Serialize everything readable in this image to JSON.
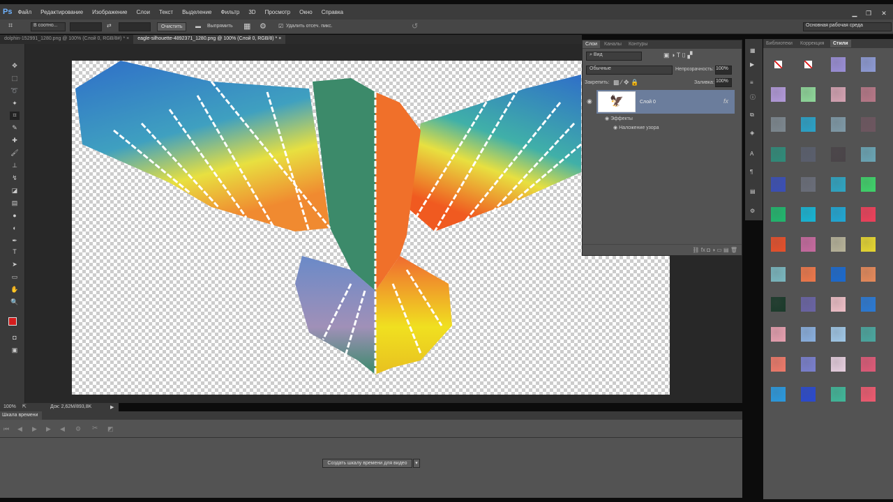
{
  "menu": {
    "logo": "Ps",
    "items": [
      "Файл",
      "Редактирование",
      "Изображение",
      "Слои",
      "Текст",
      "Выделение",
      "Фильтр",
      "3D",
      "Просмотр",
      "Окно",
      "Справка"
    ]
  },
  "window": {
    "minimize": "▁",
    "restore": "❐",
    "close": "✕"
  },
  "options": {
    "ratio": "В соотно...",
    "clear": "Очистить",
    "straighten": "Выпрямить",
    "delete_label": "Удалить отсеч. пикс.",
    "workspace": "Основная рабочая среда"
  },
  "tabs": [
    {
      "label": "dolphin-152991_1280.png @ 100% (Слой 0, RGB/8#) *",
      "close": "×"
    },
    {
      "label": "eagle-silhouette-4892371_1280.png @ 100% (Слой 0, RGB/8) *",
      "close": "×"
    }
  ],
  "status": {
    "zoom": "100%",
    "doc": "Док: 2,62M/893,8K"
  },
  "timeline": {
    "title": "Шкала времени",
    "create": "Создать шкалу времени для видео"
  },
  "layers": {
    "tabs": [
      "Слои",
      "Каналы",
      "Контуры"
    ],
    "filter": "Вид",
    "blend": "Обычные",
    "opacity_label": "Непрозрачность:",
    "opacity": "100%",
    "lock_label": "Закрепить:",
    "fill_label": "Заливка:",
    "fill": "100%",
    "layer_name": "Слой 0",
    "fx": "fx",
    "effects": "Эффекты",
    "effect": "Наложение узора"
  },
  "styles": {
    "tabs": [
      "Библиотеки",
      "Коррекция",
      "Стили"
    ],
    "swatches": [
      "none",
      "none",
      "#9b8fd8",
      "#8e9bd6",
      "#b39adb",
      "#8fd99a",
      "#d6a3b3",
      "#b87888",
      "#7d8890",
      "#2aa3c9",
      "#7f9aa8",
      "#6e5660",
      "#2f8c7a",
      "#5a5f6e",
      "#4a4448",
      "#6aa6b6",
      "#3a4fb8",
      "#6a6e7a",
      "#2ea6c4",
      "#3ed46a",
      "#20b86e",
      "#16b6d6",
      "#1fa8d6",
      "#f0405a",
      "#e8502a",
      "#c86aa0",
      "#b8b49a",
      "#e8d830",
      "#7ab8c0",
      "#f0784a",
      "#1a6ad0",
      "#e88a5a",
      "#1a3a2a",
      "#6a64a6",
      "#f0c0c8",
      "#2a7ad6",
      "#e8a0b0",
      "#8ab0e0",
      "#a0c8e8",
      "#4aa8a0",
      "#f07a6a",
      "#7a80d0",
      "#e8d0e0",
      "#e05a78",
      "#2a9ae0",
      "#2a4ad0",
      "#40b89a",
      "#f05a70"
    ]
  }
}
